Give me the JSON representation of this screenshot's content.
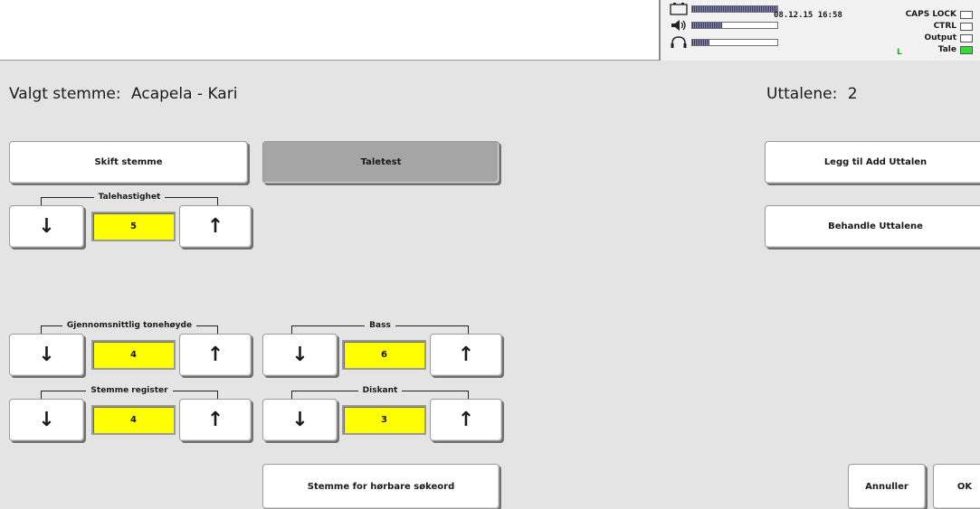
{
  "status": {
    "datetime": "08.12.15 16:58",
    "meters": [
      {
        "icon": "battery-icon",
        "level": 1.0
      },
      {
        "icon": "speaker-icon",
        "level": 0.35
      },
      {
        "icon": "headphones-icon",
        "level": 0.2
      }
    ],
    "indicators": [
      {
        "label": "CAPS LOCK",
        "active": false
      },
      {
        "label": "CTRL",
        "active": false
      },
      {
        "label": "Output",
        "active": false
      },
      {
        "label": "Tale",
        "active": true
      }
    ],
    "channel_letter": "L"
  },
  "voice": {
    "label": "Valgt stemme:",
    "value": "Acapela - Kari"
  },
  "pronunciations": {
    "label": "Uttalene:",
    "value": "2"
  },
  "buttons": {
    "change_voice": "Skift stemme",
    "speech_test": "Taletest",
    "add_pronunciation": "Legg til Add Uttalen",
    "manage_pronunciations": "Behandle Uttalene",
    "audible_keywords_voice": "Stemme for hørbare søkeord",
    "cancel": "Annuller",
    "ok": "OK"
  },
  "controls": {
    "speed": {
      "label": "Talehastighet",
      "value": "5"
    },
    "pitch": {
      "label": "Gjennomsnittlig tonehøyde",
      "value": "4"
    },
    "register": {
      "label": "Stemme register",
      "value": "4"
    },
    "bass": {
      "label": "Bass",
      "value": "6"
    },
    "treble": {
      "label": "Diskant",
      "value": "3"
    }
  },
  "icons": {
    "down": "↓",
    "up": "↑"
  },
  "colors": {
    "value_box": "#ffff00",
    "active_indicator": "#33dd33",
    "pressed_button": "#a5a5a5"
  }
}
